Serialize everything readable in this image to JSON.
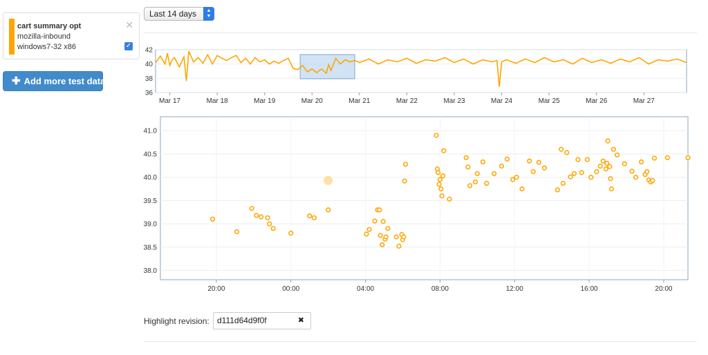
{
  "range_select": {
    "value": "Last 14 days"
  },
  "series": {
    "title": "cart summary opt",
    "branch": "mozilla-inbound",
    "platform": "windows7-32 x86",
    "color": "#ffa500",
    "checked": true
  },
  "add_button": {
    "label": "Add more test data",
    "icon": "plus-icon"
  },
  "highlight": {
    "label": "Highlight revision:",
    "value": "d111d64d9f0f"
  },
  "chart_data": [
    {
      "type": "line",
      "title": "",
      "xlabel": "",
      "ylabel": "",
      "ylim": [
        36,
        42
      ],
      "yticks": [
        "42",
        "40",
        "38",
        "36"
      ],
      "x_ticks": [
        "Mar 17",
        "Mar 18",
        "Mar 19",
        "Mar 20",
        "Mar 21",
        "Mar 22",
        "Mar 23",
        "Mar 24",
        "Mar 25",
        "Mar 26",
        "Mar 27"
      ],
      "xlim": [
        16.7,
        27.9
      ],
      "selection": [
        19.75,
        20.9
      ],
      "series": [
        {
          "color": "#ffa500",
          "x": [
            16.7,
            16.8,
            16.9,
            16.95,
            17.0,
            17.05,
            17.1,
            17.2,
            17.3,
            17.35,
            17.4,
            17.5,
            17.6,
            17.7,
            17.8,
            17.9,
            18.0,
            18.1,
            18.2,
            18.3,
            18.4,
            18.5,
            18.6,
            18.7,
            18.8,
            18.9,
            19.0,
            19.1,
            19.2,
            19.3,
            19.4,
            19.5,
            19.6,
            19.7,
            19.8,
            19.9,
            20.0,
            20.1,
            20.2,
            20.3,
            20.35,
            20.4,
            20.5,
            20.6,
            20.7,
            20.8,
            20.9,
            21.0,
            21.2,
            21.4,
            21.6,
            21.8,
            22.0,
            22.2,
            22.4,
            22.6,
            22.8,
            23.0,
            23.2,
            23.4,
            23.6,
            23.8,
            23.9,
            23.95,
            24.0,
            24.1,
            24.3,
            24.5,
            24.7,
            24.9,
            25.1,
            25.3,
            25.5,
            25.7,
            25.9,
            26.1,
            26.3,
            26.5,
            26.7,
            26.9,
            27.1,
            27.3,
            27.5,
            27.7,
            27.9
          ],
          "y": [
            40.2,
            41.1,
            40.0,
            41.5,
            39.8,
            40.6,
            40.9,
            39.6,
            41.0,
            37.6,
            41.8,
            40.3,
            40.9,
            40.1,
            41.3,
            40.0,
            41.2,
            40.8,
            40.5,
            40.9,
            41.2,
            40.2,
            40.8,
            40.0,
            40.9,
            40.3,
            40.6,
            40.0,
            40.4,
            40.1,
            40.5,
            40.8,
            39.4,
            39.2,
            39.8,
            38.9,
            39.3,
            38.8,
            39.3,
            38.7,
            39.9,
            39.1,
            40.8,
            40.0,
            40.6,
            40.3,
            40.5,
            40.2,
            40.7,
            40.0,
            40.6,
            40.3,
            40.8,
            40.1,
            40.6,
            40.4,
            40.9,
            40.2,
            40.7,
            40.0,
            40.6,
            40.3,
            40.5,
            36.8,
            40.3,
            40.6,
            40.1,
            40.7,
            40.2,
            40.9,
            40.3,
            40.6,
            40.0,
            40.8,
            40.2,
            40.6,
            40.1,
            40.7,
            40.3,
            40.9,
            40.0,
            40.6,
            40.4,
            40.7,
            40.2
          ]
        }
      ]
    },
    {
      "type": "scatter",
      "title": "",
      "xlabel": "",
      "ylabel": "",
      "ylim": [
        37.8,
        41.3
      ],
      "yticks": [
        "41.0",
        "40.5",
        "40.0",
        "39.5",
        "39.0",
        "38.5",
        "38.0"
      ],
      "x_ticks": [
        "20:00",
        "00:00",
        "04:00",
        "08:00",
        "12:00",
        "16:00",
        "20:00"
      ],
      "xlim": [
        17.0,
        45.3
      ],
      "highlighted_point": [
        26.0,
        39.93
      ],
      "series": [
        {
          "color": "#ffa500",
          "x": [
            19.8,
            21.1,
            21.9,
            22.15,
            22.4,
            22.75,
            22.85,
            23.05,
            24.0,
            25.0,
            25.25,
            26.0,
            28.05,
            28.2,
            28.5,
            28.65,
            28.75,
            28.8,
            28.9,
            28.95,
            29.05,
            29.1,
            29.2,
            29.65,
            29.8,
            29.95,
            30.0,
            30.05,
            30.1,
            30.15,
            31.8,
            31.85,
            31.9,
            31.95,
            32.0,
            32.05,
            32.1,
            32.15,
            32.2,
            32.5,
            33.4,
            33.5,
            33.6,
            33.9,
            34.0,
            34.3,
            34.5,
            34.9,
            35.3,
            35.6,
            35.9,
            36.1,
            36.4,
            36.8,
            37.0,
            37.3,
            37.6,
            38.3,
            38.5,
            38.6,
            38.8,
            39.0,
            39.2,
            39.4,
            39.6,
            39.9,
            40.1,
            40.4,
            40.6,
            40.75,
            40.9,
            40.95,
            41.0,
            41.1,
            41.15,
            41.2,
            41.3,
            41.5,
            41.9,
            42.3,
            42.5,
            42.8,
            43.0,
            43.1,
            43.2,
            43.3,
            43.4,
            43.5,
            44.2,
            45.3
          ],
          "y": [
            39.1,
            38.83,
            39.33,
            39.18,
            39.15,
            39.13,
            39.0,
            38.9,
            38.8,
            39.17,
            39.13,
            39.3,
            38.78,
            38.88,
            39.06,
            39.3,
            39.3,
            38.75,
            38.55,
            39.05,
            38.67,
            38.72,
            38.9,
            38.72,
            38.52,
            38.77,
            38.66,
            38.72,
            39.92,
            40.28,
            40.9,
            40.18,
            40.1,
            39.85,
            39.95,
            39.75,
            39.6,
            40.03,
            40.57,
            39.53,
            40.42,
            40.22,
            39.82,
            39.9,
            40.08,
            40.33,
            39.87,
            40.08,
            40.24,
            40.39,
            39.95,
            40.0,
            39.75,
            40.35,
            40.12,
            40.32,
            40.2,
            39.73,
            40.6,
            39.87,
            40.53,
            40.01,
            40.08,
            40.38,
            40.1,
            40.38,
            40.0,
            40.12,
            40.24,
            40.35,
            40.18,
            40.3,
            40.78,
            40.23,
            39.97,
            39.75,
            40.6,
            40.48,
            40.29,
            40.13,
            40.0,
            40.33,
            40.06,
            40.12,
            39.94,
            39.9,
            39.93,
            40.41,
            40.42,
            40.42
          ]
        }
      ]
    }
  ]
}
